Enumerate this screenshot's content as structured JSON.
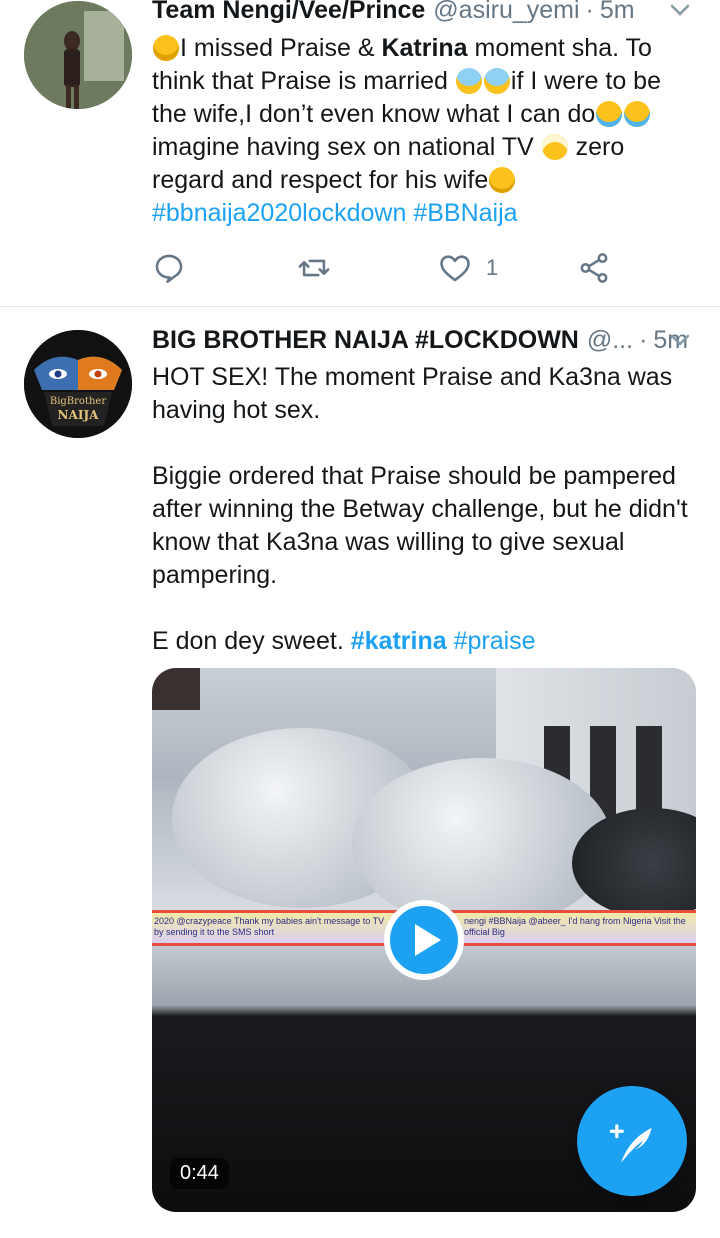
{
  "tweets": [
    {
      "name": "Team Nengi/Vee/Prince",
      "handle": "@asiru_yemi",
      "time": "5m",
      "text": {
        "line1_a": "I missed Praise & ",
        "line1_bold": "Katrina",
        "line1_b": " moment sha. To",
        "line2_a": "think that Praise is married ",
        "line2_b": "if I were to be",
        "line3": "the wife,I don’t even know what I can do",
        "line4_a": "imagine having sex on national TV ",
        "line4_b": " zero",
        "line5": "regard and respect for his wife",
        "hashtags": "#bbnaija2020lockdown #BBNaija"
      },
      "like_count": "1",
      "icons": [
        "reply-icon",
        "retweet-icon",
        "like-icon",
        "share-icon"
      ]
    },
    {
      "name": "BIG BROTHER NAIJA #LOCKDOWN",
      "handle": "@...",
      "time": "5m",
      "text": {
        "p1": "HOT SEX! The moment Praise and Ka3na was having hot sex.",
        "p2": "Biggie ordered that Praise should be pampered after winning the Betway challenge, but he didn't know that Ka3na was willing to give sexual pampering.",
        "p3_text": "E don dey sweet. ",
        "p3_tag1": "#katrina",
        "p3_tag2": "#praise"
      },
      "avatar_text_top": "BigBrother",
      "avatar_text_bottom": "NAIJA",
      "video": {
        "duration": "0:44",
        "ticker_left": "2020 @crazypeace Thank my babies ain't message to TV by sending it to the SMS short",
        "ticker_right": "nengi #BBNaija @abeer_ I'd hang from Nigeria Visit the official Big"
      }
    }
  ],
  "colors": {
    "accent": "#1da1f2",
    "secondary_text": "#657786",
    "divider": "#e1e8ed"
  },
  "fab": {
    "icon": "compose-feather-icon"
  }
}
